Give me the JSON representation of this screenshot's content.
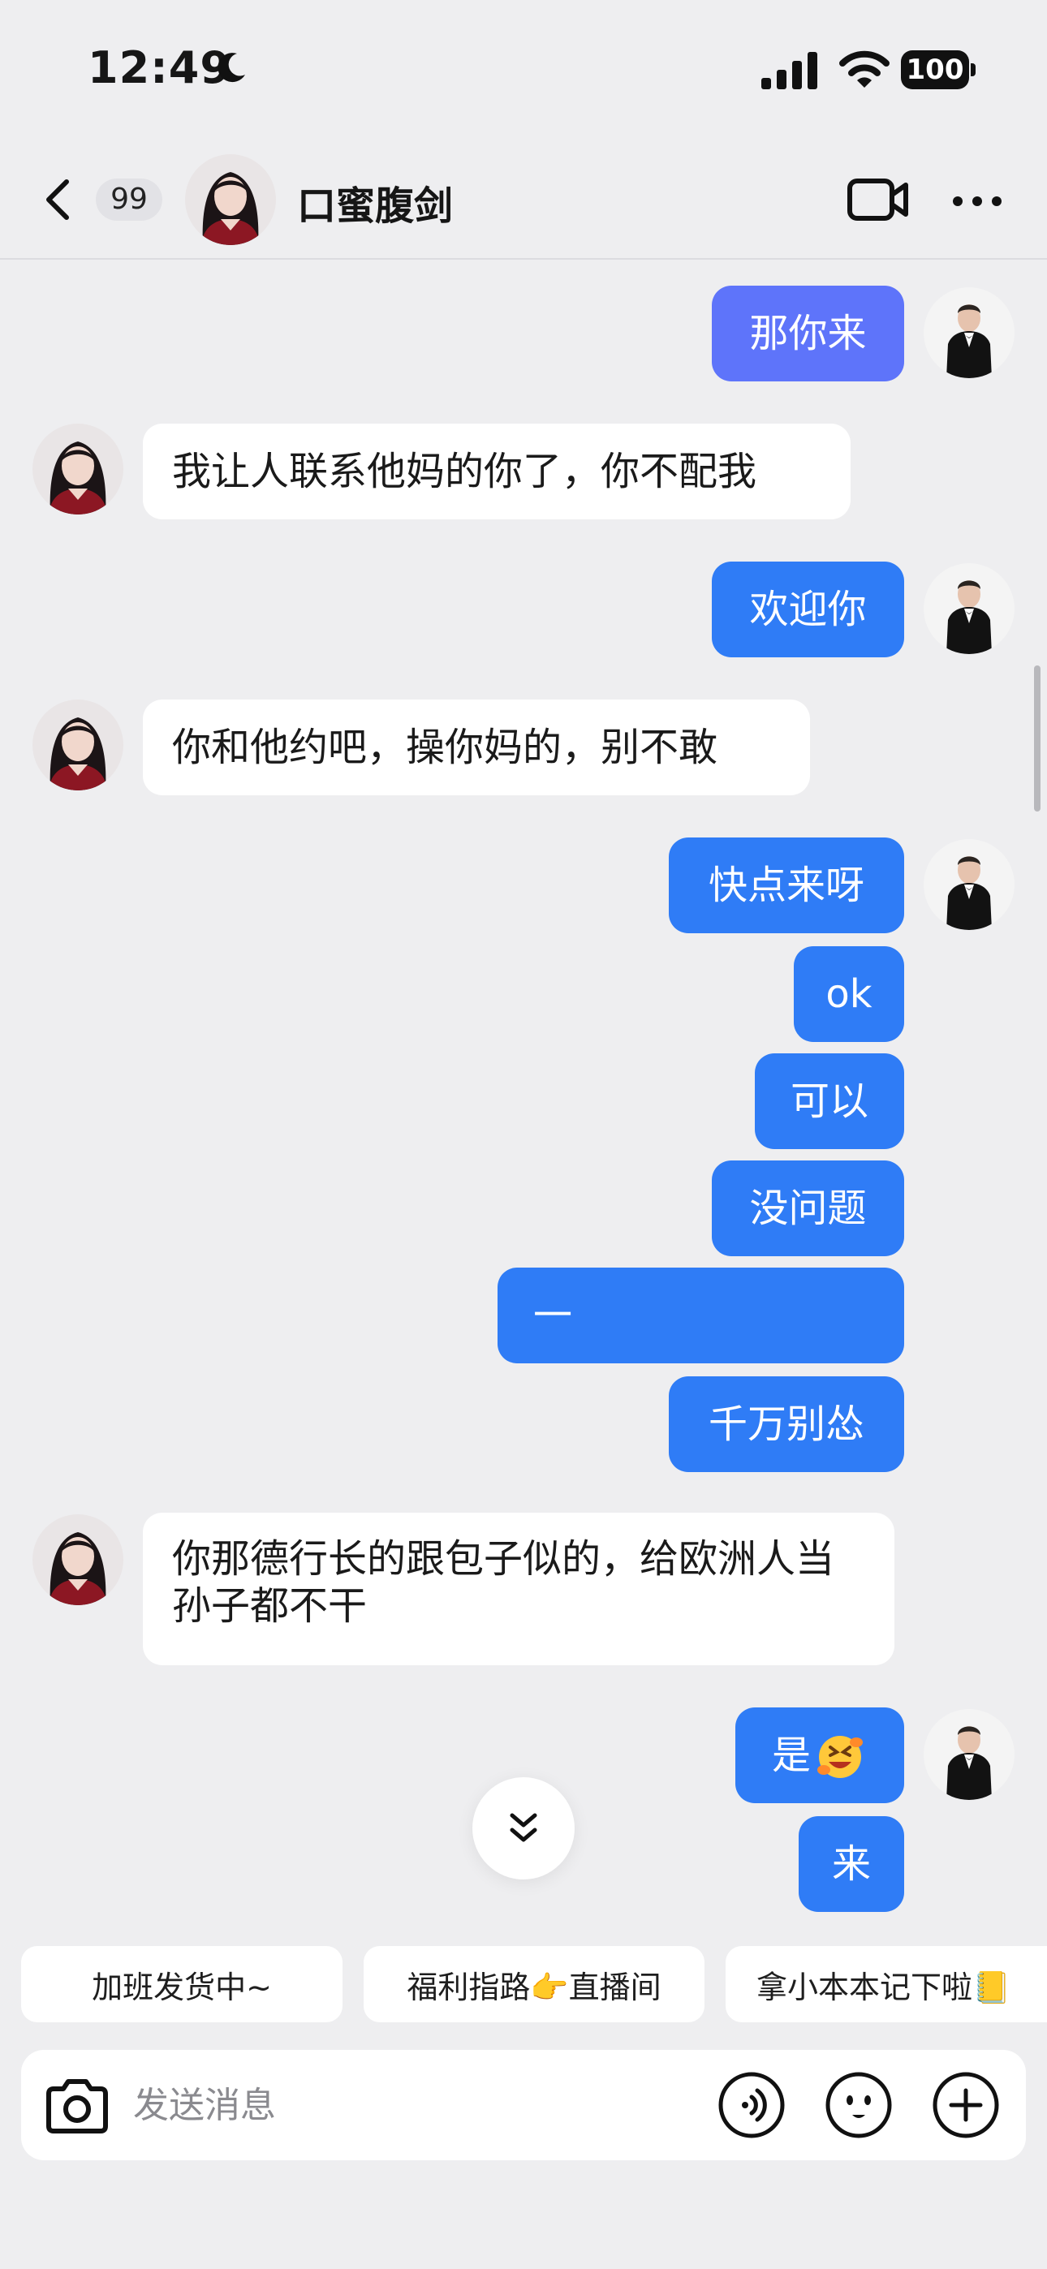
{
  "status_bar": {
    "time": "12:49",
    "battery": "100"
  },
  "header": {
    "unread_count": "99",
    "contact_name": "口蜜腹剑"
  },
  "messages": [
    {
      "side": "out",
      "text": "那你来"
    },
    {
      "side": "in",
      "text": "我让人联系他妈的你了，你不配我"
    },
    {
      "side": "out",
      "text": "欢迎你"
    },
    {
      "side": "in",
      "text": "你和他约吧，操你妈的，别不敢"
    },
    {
      "side": "out",
      "text": "快点来呀"
    },
    {
      "side": "out",
      "text": "ok"
    },
    {
      "side": "out",
      "text": "可以"
    },
    {
      "side": "out",
      "text": "没问题"
    },
    {
      "side": "out",
      "text": "一"
    },
    {
      "side": "out",
      "text": "千万别怂"
    },
    {
      "side": "in",
      "text": "你那德行长的跟包子似的，给欧洲人当孙子都不干"
    },
    {
      "side": "out",
      "text": "是"
    },
    {
      "side": "out",
      "text": "来"
    }
  ],
  "quick_replies": [
    "加班发货中~",
    "福利指路👉直播间",
    "拿小本本记下啦📒"
  ],
  "input": {
    "placeholder": "发送消息",
    "value": ""
  },
  "colors": {
    "outgoing_bubble": "#2f7cf6",
    "outgoing_bubble_first": "#5e74fa",
    "incoming_bubble": "#ffffff",
    "background": "#eeeef0"
  },
  "icons": [
    "back-icon",
    "video-call-icon",
    "more-icon",
    "scroll-down-icon",
    "camera-icon",
    "voice-icon",
    "emoji-icon",
    "plus-icon"
  ]
}
